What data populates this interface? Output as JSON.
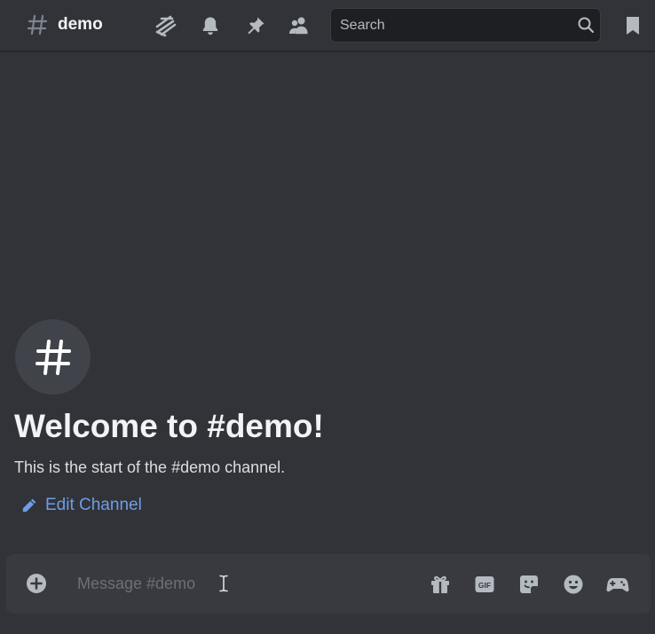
{
  "header": {
    "channel_icon": "hash-icon",
    "channel_name": "demo",
    "icons": [
      "threads-icon",
      "bell-icon",
      "pin-icon",
      "members-icon",
      "bookmark-icon"
    ],
    "search": {
      "placeholder": "Search",
      "icon": "search-icon"
    }
  },
  "welcome": {
    "avatar_icon": "hash-icon",
    "title": "Welcome to #demo!",
    "subtitle": "This is the start of the #demo channel.",
    "edit_label": "Edit Channel",
    "edit_icon": "pencil-icon"
  },
  "composer": {
    "placeholder": "Message #demo",
    "icons": [
      "add-icon",
      "gift-icon",
      "gif-icon",
      "sticker-icon",
      "emoji-icon",
      "activity-icon"
    ],
    "gif_label": "GIF"
  },
  "colors": {
    "background": "#313338",
    "composer": "#383a40",
    "search_bg": "#1e1f22",
    "link": "#6e9de4",
    "icon": "#b5bac1",
    "title": "#f2f3f5"
  }
}
